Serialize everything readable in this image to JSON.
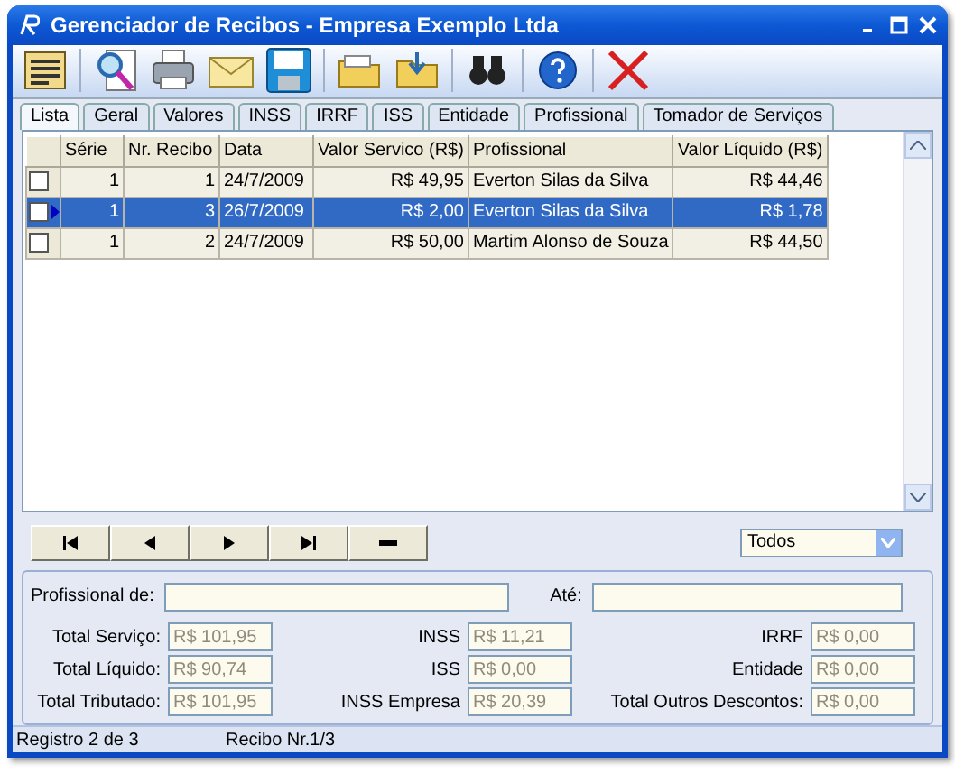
{
  "window": {
    "title": "Gerenciador de Recibos - Empresa Exemplo Ltda"
  },
  "tabs": [
    {
      "label": "Lista",
      "selected": true
    },
    {
      "label": "Geral",
      "selected": false
    },
    {
      "label": "Valores",
      "selected": false
    },
    {
      "label": "INSS",
      "selected": false
    },
    {
      "label": "IRRF",
      "selected": false
    },
    {
      "label": "ISS",
      "selected": false
    },
    {
      "label": "Entidade",
      "selected": false
    },
    {
      "label": "Profissional",
      "selected": false
    },
    {
      "label": "Tomador de Serviços",
      "selected": false
    }
  ],
  "table": {
    "columns": [
      "Série",
      "Nr. Recibo",
      "Data",
      "Valor Servico (R$)",
      "Profissional",
      "Valor Líquido (R$)"
    ],
    "rows": [
      {
        "cells": [
          "1",
          "1",
          "24/7/2009",
          "R$ 49,95",
          "Everton Silas da Silva",
          "R$ 44,46"
        ],
        "checked": false,
        "selected": false
      },
      {
        "cells": [
          "1",
          "3",
          "26/7/2009",
          "R$ 2,00",
          "Everton Silas da Silva",
          "R$ 1,78"
        ],
        "checked": false,
        "selected": true
      },
      {
        "cells": [
          "1",
          "2",
          "24/7/2009",
          "R$ 50,00",
          "Martim Alonso de Souza",
          "R$ 44,50"
        ],
        "checked": false,
        "selected": false
      }
    ]
  },
  "filter_dropdown": {
    "value": "Todos"
  },
  "filters": [
    {
      "label": "Profissional de:"
    },
    {
      "label": "Até:"
    }
  ],
  "totals": [
    {
      "label": "Total Serviço:",
      "value": "R$ 101,95",
      "disabled": true
    },
    {
      "label": "INSS",
      "value": "R$ 11,21",
      "disabled": true
    },
    {
      "label": "IRRF",
      "value": "R$ 0,00",
      "disabled": true
    },
    {
      "label": "Total Líquido:",
      "value": "R$ 90,74",
      "disabled": true
    },
    {
      "label": "ISS",
      "value": "R$ 0,00",
      "disabled": true
    },
    {
      "label": "Entidade",
      "value": "R$ 0,00",
      "disabled": true
    },
    {
      "label": "Total Tributado:",
      "value": "R$ 101,95",
      "disabled": true
    },
    {
      "label": "INSS Empresa",
      "value": "R$ 20,39",
      "disabled": true
    },
    {
      "label": "Total Outros Descontos:",
      "value": "R$ 0,00",
      "disabled": true
    }
  ],
  "status_bar": [
    "Registro 2 de 3",
    "Recibo Nr.1/3"
  ]
}
